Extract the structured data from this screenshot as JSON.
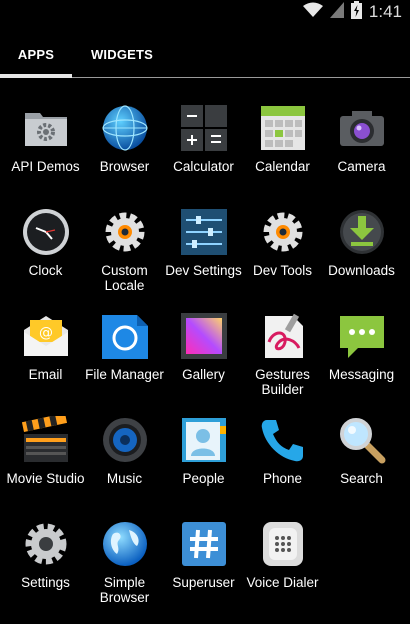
{
  "status_bar": {
    "time": "1:41",
    "icons": [
      "wifi-icon",
      "signal-icon",
      "battery-charging-icon"
    ]
  },
  "tabs": [
    {
      "label": "APPS",
      "selected": true
    },
    {
      "label": "WIDGETS",
      "selected": false
    }
  ],
  "apps": [
    {
      "label": "API Demos",
      "icon": "folder-gear-icon"
    },
    {
      "label": "Browser",
      "icon": "globe-icon"
    },
    {
      "label": "Calculator",
      "icon": "calculator-icon"
    },
    {
      "label": "Calendar",
      "icon": "calendar-icon"
    },
    {
      "label": "Camera",
      "icon": "camera-icon"
    },
    {
      "label": "Clock",
      "icon": "clock-icon"
    },
    {
      "label": "Custom Locale",
      "icon": "gear-icon"
    },
    {
      "label": "Dev Settings",
      "icon": "sliders-icon"
    },
    {
      "label": "Dev Tools",
      "icon": "gear-icon"
    },
    {
      "label": "Downloads",
      "icon": "download-icon"
    },
    {
      "label": "Email",
      "icon": "envelope-icon"
    },
    {
      "label": "File Manager",
      "icon": "file-manager-icon"
    },
    {
      "label": "Gallery",
      "icon": "gallery-icon"
    },
    {
      "label": "Gestures Builder",
      "icon": "gestures-icon"
    },
    {
      "label": "Messaging",
      "icon": "message-bubble-icon"
    },
    {
      "label": "Movie Studio",
      "icon": "clapperboard-icon"
    },
    {
      "label": "Music",
      "icon": "speaker-icon"
    },
    {
      "label": "People",
      "icon": "contacts-icon"
    },
    {
      "label": "Phone",
      "icon": "phone-handset-icon"
    },
    {
      "label": "Search",
      "icon": "magnifier-icon"
    },
    {
      "label": "Settings",
      "icon": "settings-gear-icon"
    },
    {
      "label": "Simple Browser",
      "icon": "globe-icon"
    },
    {
      "label": "Superuser",
      "icon": "hash-icon"
    },
    {
      "label": "Voice Dialer",
      "icon": "voice-dialer-icon"
    }
  ]
}
